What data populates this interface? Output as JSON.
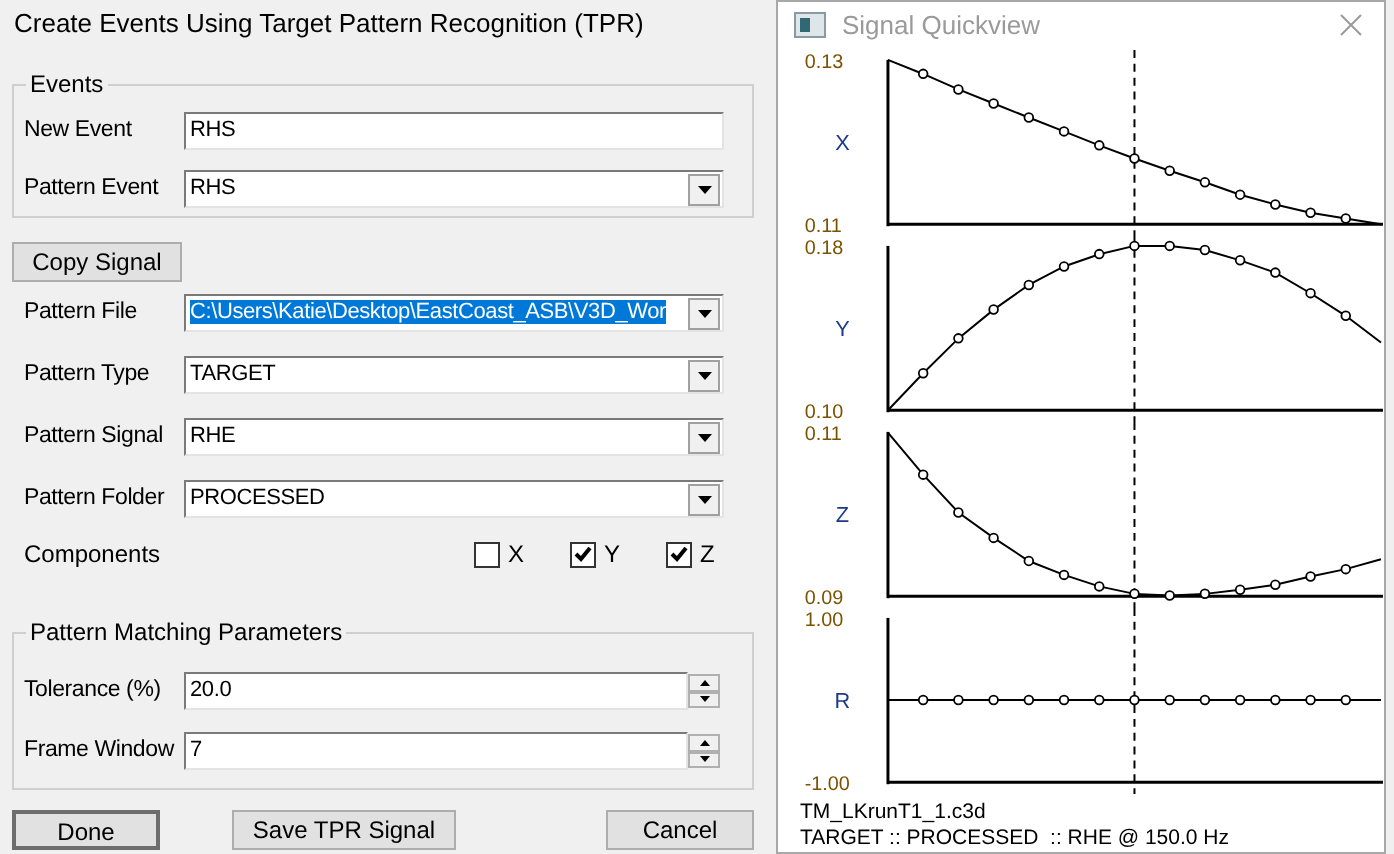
{
  "dialog": {
    "title": "Create Events Using Target Pattern Recognition (TPR)",
    "events": {
      "legend": "Events",
      "fields": [
        {
          "kind": "text",
          "label": "New Event",
          "value": "RHS"
        },
        {
          "kind": "combo",
          "label": "Pattern Event",
          "value": "RHS",
          "highlighted": false
        }
      ]
    },
    "copy_button": "Copy Signal",
    "pattern_fields": [
      {
        "kind": "combo",
        "label": "Pattern File",
        "value": "C:\\Users\\Katie\\Desktop\\EastCoast_ASB\\V3D_Wor",
        "highlighted": true
      },
      {
        "kind": "combo",
        "label": "Pattern Type",
        "value": "TARGET",
        "highlighted": false
      },
      {
        "kind": "combo",
        "label": "Pattern Signal",
        "value": "RHE",
        "highlighted": false
      },
      {
        "kind": "combo",
        "label": "Pattern Folder",
        "value": "PROCESSED",
        "highlighted": false
      }
    ],
    "components": {
      "label": "Components",
      "options": [
        {
          "label": "X",
          "checked": false
        },
        {
          "label": "Y",
          "checked": true
        },
        {
          "label": "Z",
          "checked": true
        }
      ]
    },
    "matching": {
      "legend": "Pattern Matching Parameters",
      "fields": [
        {
          "kind": "spin",
          "label": "Tolerance (%)",
          "value": "20.0"
        },
        {
          "kind": "spin",
          "label": "Frame Window",
          "value": "7"
        }
      ]
    },
    "buttons": [
      {
        "label": "Done",
        "default": true
      },
      {
        "label": "Save TPR Signal",
        "default": false
      },
      {
        "label": "Cancel",
        "default": false
      }
    ]
  },
  "quickview": {
    "title": "Signal Quickview",
    "panels": [
      {
        "chart_data": {
          "type": "line",
          "ylabel": "X",
          "ylim": [
            0.11,
            0.13
          ],
          "yticks": [
            {
              "value": 0.13,
              "label": "0.13"
            },
            {
              "value": 0.11,
              "label": "0.11"
            }
          ],
          "series": [
            {
              "color": "#000000",
              "marker": "o",
              "values": [
                0.13,
                0.1283,
                0.1264,
                0.1247,
                0.123,
                0.1213,
                0.1196,
                0.118,
                0.1165,
                0.1151,
                0.1136,
                0.1124,
                0.1114,
                0.1107,
                0.11
              ]
            }
          ]
        }
      },
      {
        "chart_data": {
          "type": "line",
          "ylabel": "Y",
          "ylim": [
            0.1,
            0.18
          ],
          "yticks": [
            {
              "value": 0.18,
              "label": "0.18"
            },
            {
              "value": 0.1,
              "label": "0.10"
            }
          ],
          "series": [
            {
              "color": "#000000",
              "marker": "o",
              "values": [
                0.1,
                0.118,
                0.135,
                0.149,
                0.161,
                0.17,
                0.176,
                0.18,
                0.18,
                0.178,
                0.173,
                0.167,
                0.157,
                0.146,
                0.133
              ]
            }
          ]
        }
      },
      {
        "chart_data": {
          "type": "line",
          "ylabel": "Z",
          "ylim": [
            0.09,
            0.11
          ],
          "yticks": [
            {
              "value": 0.11,
              "label": "0.11"
            },
            {
              "value": 0.09,
              "label": "0.09"
            }
          ],
          "series": [
            {
              "color": "#000000",
              "marker": "o",
              "values": [
                0.1099,
                0.1048,
                0.1002,
                0.0971,
                0.0943,
                0.0926,
                0.0912,
                0.0903,
                0.0901,
                0.0903,
                0.0908,
                0.0914,
                0.0924,
                0.0933,
                0.0945
              ]
            }
          ]
        }
      },
      {
        "chart_data": {
          "type": "line",
          "ylabel": "R",
          "ylim": [
            -1,
            1
          ],
          "yticks": [
            {
              "value": 1,
              "label": "1.00"
            },
            {
              "value": -1,
              "label": "-1.00"
            }
          ],
          "series": [
            {
              "color": "#000000",
              "marker": "o",
              "values": [
                0,
                0,
                0,
                0,
                0,
                0,
                0,
                0,
                0,
                0,
                0,
                0,
                0,
                0,
                0
              ]
            }
          ]
        }
      }
    ],
    "footer": [
      "TM_LKrunT1_1.c3d",
      "TARGET :: PROCESSED  :: RHE @ 150.0 Hz"
    ]
  }
}
